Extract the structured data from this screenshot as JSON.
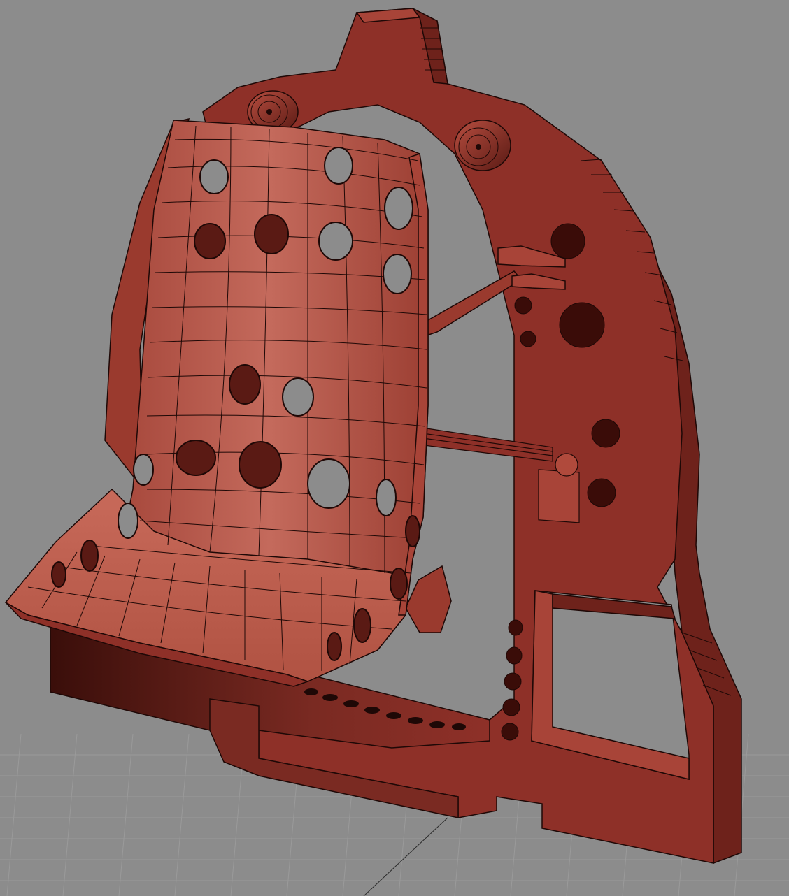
{
  "viewport": {
    "colors": {
      "background": "#8c8c8c",
      "grid": "#9a9a9a",
      "model_mid": "#8e3028",
      "model_light": "#b04a3c",
      "model_dark": "#4a1410",
      "wire": "#1e0806"
    }
  }
}
